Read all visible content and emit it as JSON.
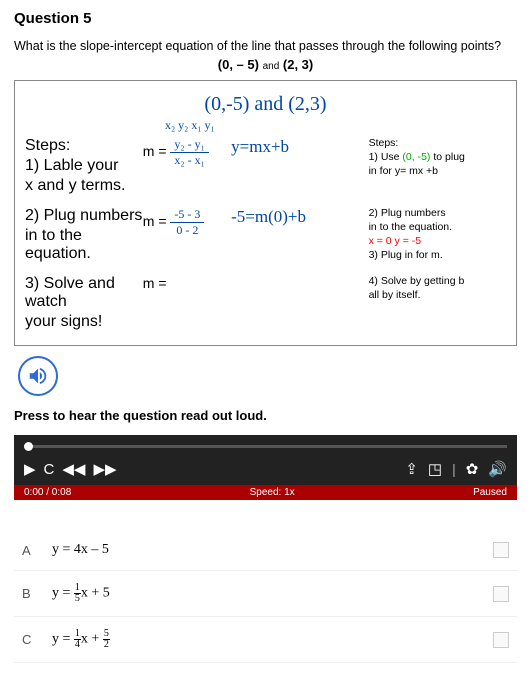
{
  "question": {
    "number": "Question 5",
    "prompt": "What is the slope-intercept equation of the line that passes through the following points?",
    "point1": "(0, – 5)",
    "and": "and",
    "point2": "(2, 3)"
  },
  "work": {
    "top_points": "(0,-5) and (2,3)",
    "sub_labels": "x₂ y₂        x₁ y₁",
    "left": {
      "steps_hdr": "Steps:",
      "s1a": "1) Lable your",
      "s1b": "x and y terms.",
      "s2a": "2) Plug numbers",
      "s2b": "in to the equation.",
      "s3a": "3) Solve and watch",
      "s3b": "your signs!"
    },
    "mid": {
      "m1": "m =",
      "f1t": "y₂ - y₁",
      "f1b": "x₂ - x₁",
      "m2": "m =",
      "f2t": "-5 - 3",
      "f2b": "0 - 2",
      "m3": "m ="
    },
    "r1": {
      "eq1": "y=mx+b",
      "eq2": "-5=m(0)+b"
    },
    "right": {
      "steps_hdr": "Steps:",
      "s1a": "1) Use",
      "s1a_pt": "(0, -5)",
      "s1a_end": "to plug",
      "s1b": "in for y= mx +b",
      "s2a": "2) Plug numbers",
      "s2b": "in to the equation.",
      "s2c": "x = 0    y = -5",
      "s3": "3) Plug in for m.",
      "s4a": "4) Solve by getting b",
      "s4b": "all by itself."
    }
  },
  "audio_label": "Press to hear the question read out loud.",
  "player": {
    "time": "0:00 / 0:08",
    "speed": "Speed: 1x",
    "status": "Paused"
  },
  "answers": {
    "a": {
      "letter": "A",
      "text": "y = 4x – 5"
    },
    "b": {
      "letter": "B",
      "pre": "y = ",
      "num": "1",
      "den": "5",
      "post": "x + 5"
    },
    "c": {
      "letter": "C",
      "pre": "y = ",
      "num": "1",
      "den": "4",
      "mid": "x + ",
      "num2": "5",
      "den2": "2"
    }
  }
}
